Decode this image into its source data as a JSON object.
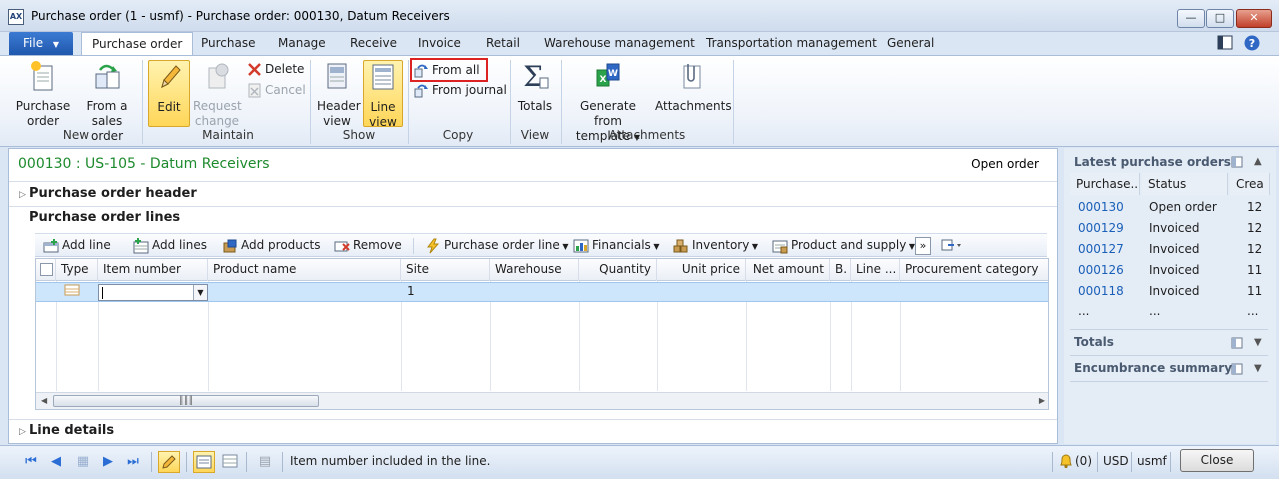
{
  "window": {
    "title": "Purchase order (1 - usmf) - Purchase order: 000130, Datum Receivers",
    "app_icon_text": "AX"
  },
  "ribbon_tabs": {
    "file": "File",
    "items": [
      "Purchase order",
      "Purchase",
      "Manage",
      "Receive",
      "Invoice",
      "Retail",
      "Warehouse management",
      "Transportation management",
      "General"
    ],
    "active": "Purchase order"
  },
  "ribbon": {
    "groups": {
      "new": "New",
      "maintain": "Maintain",
      "show": "Show",
      "copy": "Copy",
      "view": "View",
      "attachments": "Attachments"
    },
    "purchase_order": "Purchase order",
    "from_sales_order": "From a sales order",
    "edit": "Edit",
    "request_change": "Request change",
    "delete": "Delete",
    "cancel": "Cancel",
    "header_view": "Header view",
    "line_view": "Line view",
    "from_all": "From all",
    "from_journal": "From journal",
    "totals": "Totals",
    "generate_from_template": "Generate from template",
    "attachments": "Attachments"
  },
  "header": {
    "title": "000130 : US-105 - Datum Receivers",
    "status": "Open order"
  },
  "sections": {
    "po_header": "Purchase order header",
    "po_lines": "Purchase order lines",
    "line_details": "Line details"
  },
  "lines_toolbar": {
    "add_line": "Add line",
    "add_lines": "Add lines",
    "add_products": "Add products",
    "remove": "Remove",
    "purchase_order_line": "Purchase order line",
    "financials": "Financials",
    "inventory": "Inventory",
    "product_and_supply": "Product and supply",
    "more": "»"
  },
  "lines_grid": {
    "columns": [
      "Type",
      "Item number",
      "Product name",
      "Site",
      "Warehouse",
      "Quantity",
      "Unit price",
      "Net amount",
      "B.",
      "Line ...",
      "Procurement category"
    ],
    "rows": [
      {
        "item_number": "",
        "product_name": "",
        "site": "1",
        "warehouse": "",
        "quantity": "",
        "unit_price": "",
        "net_amount": ""
      }
    ]
  },
  "right_pane": {
    "latest_title": "Latest purchase orders",
    "columns": [
      "Purchase...",
      "Status",
      "Crea"
    ],
    "rows": [
      {
        "po": "000130",
        "status": "Open order",
        "created": "12"
      },
      {
        "po": "000129",
        "status": "Invoiced",
        "created": "12"
      },
      {
        "po": "000127",
        "status": "Invoiced",
        "created": "12"
      },
      {
        "po": "000126",
        "status": "Invoiced",
        "created": "11"
      },
      {
        "po": "000118",
        "status": "Invoiced",
        "created": "11"
      }
    ],
    "ellipsis": [
      "...",
      "...",
      "..."
    ],
    "totals": "Totals",
    "encumbrance": "Encumbrance summary"
  },
  "statusbar": {
    "message": "Item number included in the line.",
    "notifications": "(0)",
    "currency": "USD",
    "company": "usmf",
    "close": "Close"
  },
  "colors": {
    "accent": "#1f58ad",
    "title_green": "#1d8a2d",
    "highlight_red": "#dd2222",
    "selected_row": "#cde6fb"
  }
}
